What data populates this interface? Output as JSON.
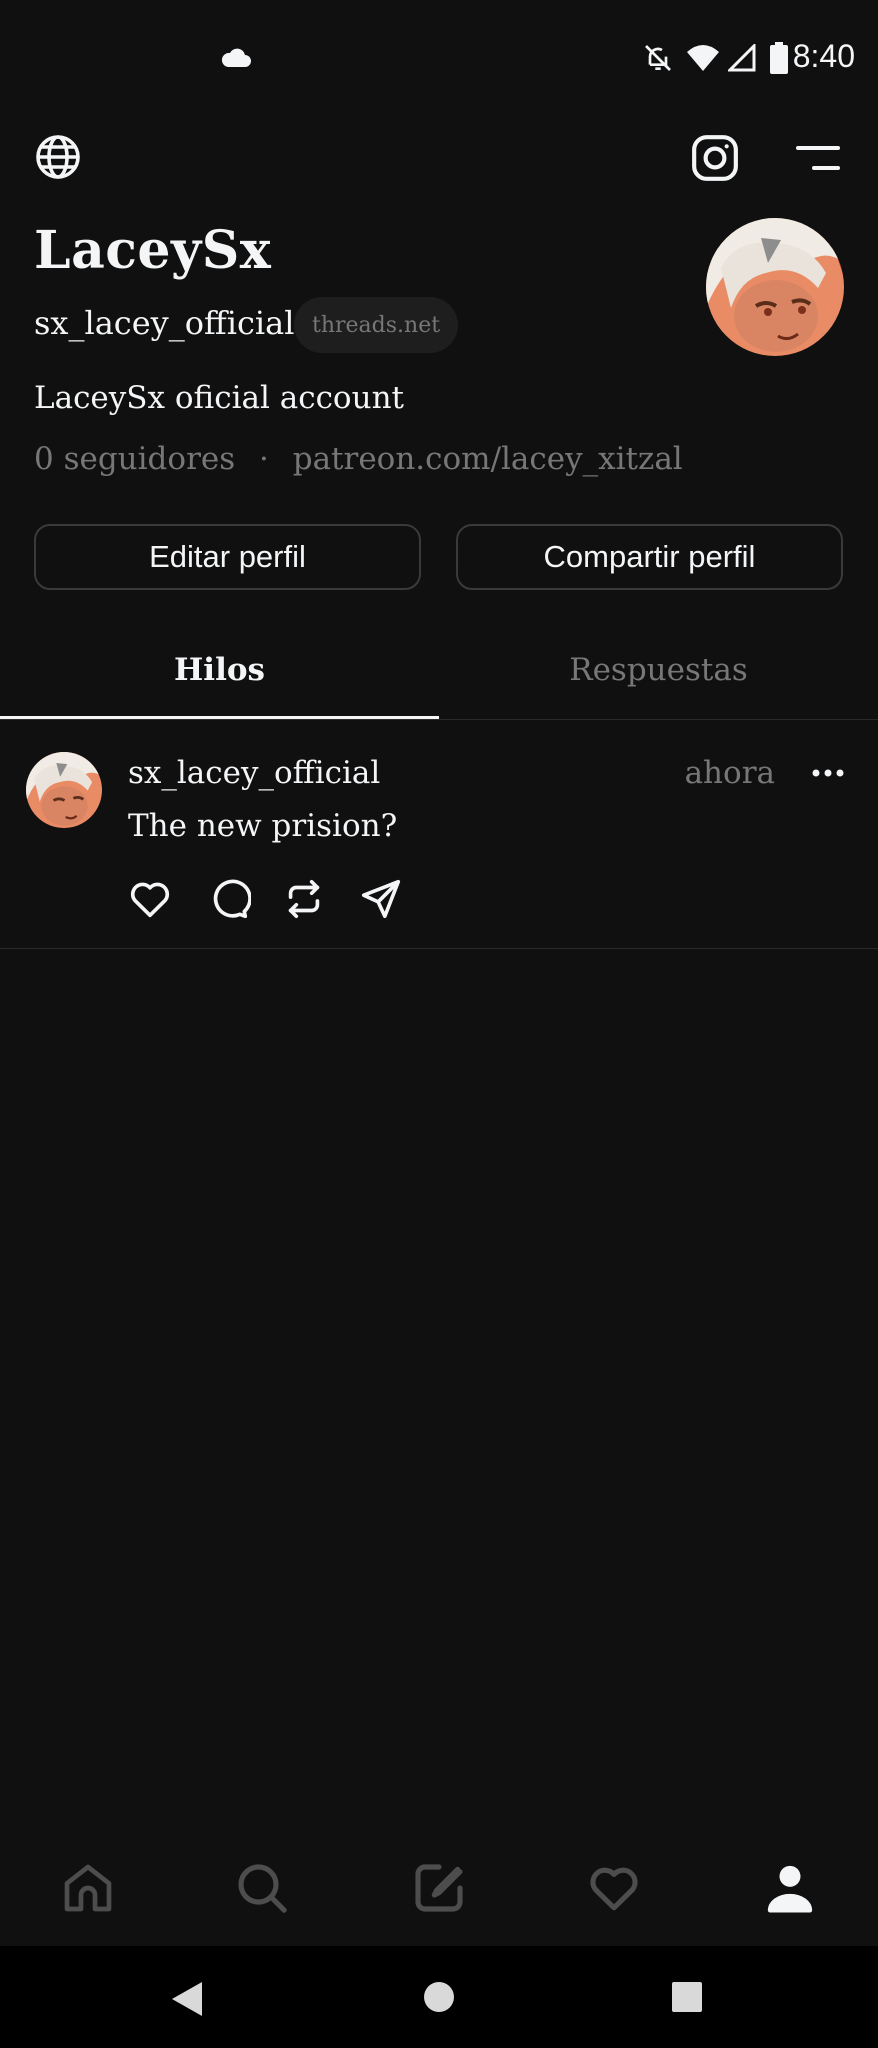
{
  "status_bar": {
    "time": "8:40",
    "icons": [
      "cloud-icon",
      "bell-off-icon",
      "wifi-icon",
      "signal-icon",
      "battery-icon"
    ]
  },
  "header": {
    "left_icon": "globe-icon",
    "right_icons": [
      "instagram-icon",
      "menu-icon"
    ]
  },
  "profile": {
    "name": "LaceySx",
    "handle": "sx_lacey_official",
    "domain_badge": "threads.net",
    "bio": "LaceySx oficial account",
    "followers": "0 seguidores",
    "separator": "·",
    "link": "patreon.com/lacey_xitzal"
  },
  "actions": {
    "edit_label": "Editar perfil",
    "share_label": "Compartir perfil"
  },
  "tabs": [
    {
      "label": "Hilos",
      "active": true
    },
    {
      "label": "Respuestas",
      "active": false
    }
  ],
  "posts": [
    {
      "user": "sx_lacey_official",
      "time": "ahora",
      "text": "The new prision?",
      "actions": [
        "heart-icon",
        "comment-icon",
        "repost-icon",
        "share-icon"
      ]
    }
  ],
  "bottom_nav": [
    "home-icon",
    "search-icon",
    "compose-icon",
    "activity-heart-icon",
    "profile-icon"
  ],
  "system_nav": [
    "back-icon",
    "home-circle-icon",
    "recents-icon"
  ],
  "colors": {
    "background": "#101010",
    "text_primary": "#f3f5f7",
    "text_secondary": "#777777",
    "border": "#3a3a3a",
    "badge_bg": "#1e1e1e"
  }
}
